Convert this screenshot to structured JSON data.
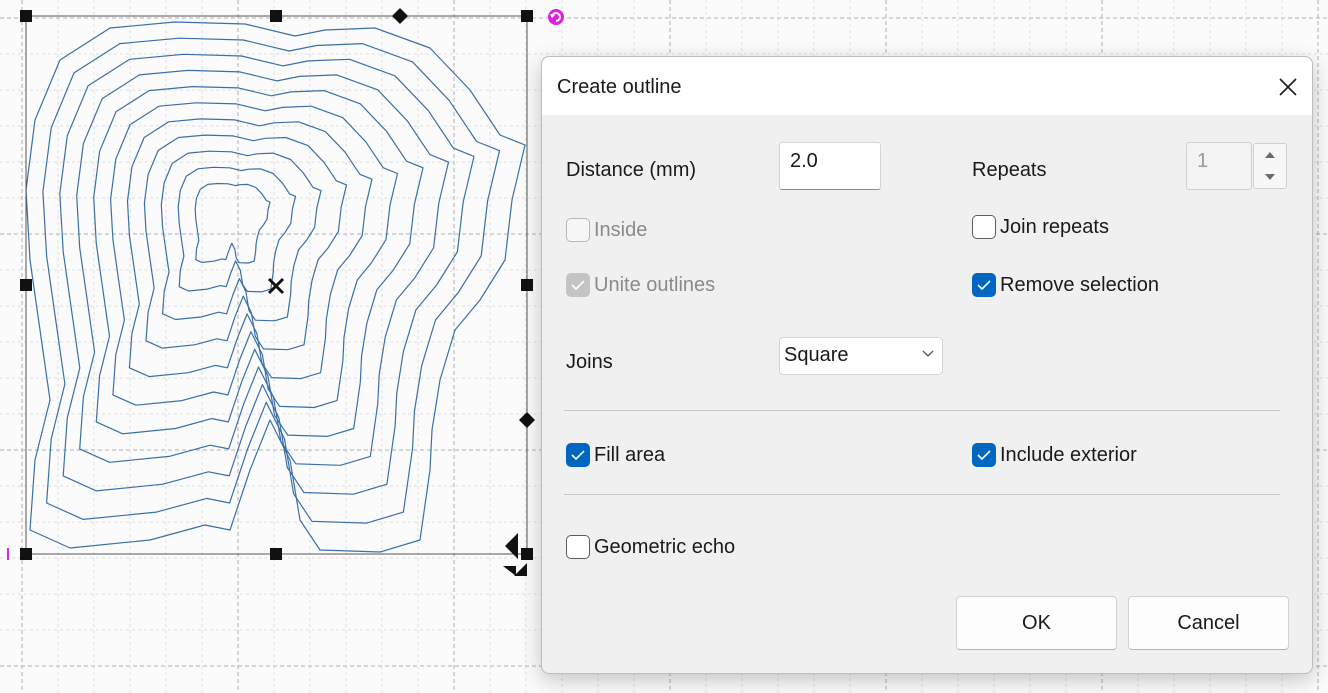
{
  "dialog": {
    "title": "Create outline",
    "distance": {
      "label": "Distance (mm)",
      "value": "2.0"
    },
    "repeats": {
      "label": "Repeats",
      "value": "1"
    },
    "inside": {
      "label": "Inside",
      "checked": false,
      "enabled": false
    },
    "unite_outlines": {
      "label": "Unite outlines",
      "checked": true,
      "enabled": false
    },
    "join_repeats": {
      "label": "Join repeats",
      "checked": false,
      "enabled": true
    },
    "remove_selection": {
      "label": "Remove selection",
      "checked": true,
      "enabled": true
    },
    "joins": {
      "label": "Joins",
      "selected": "Square"
    },
    "fill_area": {
      "label": "Fill area",
      "checked": true
    },
    "include_exterior": {
      "label": "Include exterior",
      "checked": true
    },
    "geometric_echo": {
      "label": "Geometric echo",
      "checked": false
    },
    "ok_label": "OK",
    "cancel_label": "Cancel"
  },
  "colors": {
    "accent": "#0067c0",
    "outline_stroke": "#3a6fa8",
    "rotate_handle": "#e020e0"
  },
  "icons": {
    "close": "close-icon",
    "rotate": "rotate-handle-icon",
    "center": "center-cross-icon",
    "move": "move-cursor-icon"
  }
}
